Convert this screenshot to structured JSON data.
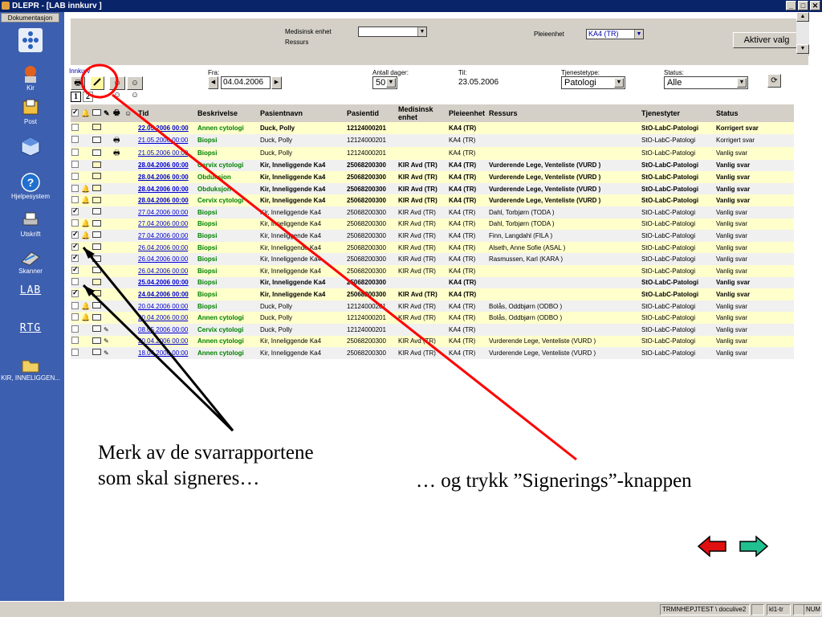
{
  "window": {
    "title": "DLEPR - [LAB innkurv  ]",
    "buttons": [
      "_",
      "□",
      "✕"
    ]
  },
  "sidebar": {
    "tab": "Dokumentasjon",
    "items": [
      {
        "label": "",
        "icon": "grid-dots-icon"
      },
      {
        "label": "Kir",
        "icon": "doctor-icon"
      },
      {
        "label": "Post",
        "icon": "post-icon"
      },
      {
        "label": "",
        "icon": "cube-icon"
      },
      {
        "label": "Hjelpesystem",
        "icon": "help-icon"
      },
      {
        "label": "Utskrift",
        "icon": "printer-icon"
      },
      {
        "label": "Skanner",
        "icon": "scanner-icon"
      }
    ],
    "links": [
      "LAB",
      "RTG"
    ],
    "folder_label": "KIR, INNELIGGEN..."
  },
  "top": {
    "medisinsk_enhet_label": "Medisinsk enhet",
    "ressurs_label": "Ressurs",
    "pleieenhet_label": "Pleieenhet",
    "pleieenhet_value": "KA4 (TR)",
    "aktiver_label": "Aktiver valg"
  },
  "toolbar": {
    "innkurv": "Innkurv",
    "pages": [
      "1",
      "2"
    ],
    "fra_label": "Fra:",
    "fra_value": "04.04.2006",
    "antall_label": "Antall dager:",
    "antall_value": "50",
    "til_label": "Til:",
    "til_value": "23.05.2006",
    "tjenestetype_label": "Tjenestetype:",
    "tjenestetype_value": "Patologi",
    "status_label": "Status:",
    "status_value": "Alle"
  },
  "table": {
    "headers": {
      "tid": "Tid",
      "beskrivelse": "Beskrivelse",
      "pasientnavn": "Pasientnavn",
      "pasientid": "Pasientid",
      "medisinsk_enhet": "Medisinsk enhet",
      "pleieenhet": "Pleieenhet",
      "ressurs": "Ressurs",
      "tjenestyter": "Tjenestyter",
      "status": "Status"
    },
    "rows": [
      {
        "checked": false,
        "bell": false,
        "env": "closed",
        "pen": false,
        "printer": false,
        "tid": "22.05.2006 00:00",
        "beskrivelse": "Annen cytologi",
        "pasientnavn": "Duck, Polly",
        "pasientid": "12124000201",
        "medenhet": "",
        "pleieenhet": "KA4 (TR)",
        "ressurs": "",
        "tjenestyter": "StO-LabC-Patologi",
        "status": "Korrigert svar",
        "bold": true
      },
      {
        "checked": false,
        "bell": false,
        "env": "open",
        "pen": false,
        "printer": true,
        "tid": "21.05.2006 00:00",
        "beskrivelse": "Biopsi",
        "pasientnavn": "Duck, Polly",
        "pasientid": "12124000201",
        "medenhet": "",
        "pleieenhet": "KA4 (TR)",
        "ressurs": "",
        "tjenestyter": "StO-LabC-Patologi",
        "status": "Korrigert svar",
        "bold": false
      },
      {
        "checked": false,
        "bell": false,
        "env": "open",
        "pen": false,
        "printer": true,
        "tid": "21.05.2006 00:00",
        "beskrivelse": "Biopsi",
        "pasientnavn": "Duck, Polly",
        "pasientid": "12124000201",
        "medenhet": "",
        "pleieenhet": "KA4 (TR)",
        "ressurs": "",
        "tjenestyter": "StO-LabC-Patologi",
        "status": "Vanlig svar",
        "bold": false
      },
      {
        "checked": false,
        "bell": false,
        "env": "closed",
        "pen": false,
        "printer": false,
        "tid": "28.04.2006 00:00",
        "beskrivelse": "Cervix cytologi",
        "pasientnavn": "Kir, Inneliggende Ka4",
        "pasientid": "25068200300",
        "medenhet": "KIR Avd (TR)",
        "pleieenhet": "KA4 (TR)",
        "ressurs": "Vurderende Lege, Venteliste (VURD )",
        "tjenestyter": "StO-LabC-Patologi",
        "status": "Vanlig svar",
        "bold": true
      },
      {
        "checked": false,
        "bell": false,
        "env": "closed",
        "pen": false,
        "printer": false,
        "tid": "28.04.2006 00:00",
        "beskrivelse": "Obduksjon",
        "pasientnavn": "Kir, Inneliggende Ka4",
        "pasientid": "25068200300",
        "medenhet": "KIR Avd (TR)",
        "pleieenhet": "KA4 (TR)",
        "ressurs": "Vurderende Lege, Venteliste (VURD )",
        "tjenestyter": "StO-LabC-Patologi",
        "status": "Vanlig svar",
        "bold": true
      },
      {
        "checked": false,
        "bell": true,
        "env": "closed",
        "pen": false,
        "printer": false,
        "tid": "28.04.2006 00:00",
        "beskrivelse": "Obduksjon",
        "pasientnavn": "Kir, Inneliggende Ka4",
        "pasientid": "25068200300",
        "medenhet": "KIR Avd (TR)",
        "pleieenhet": "KA4 (TR)",
        "ressurs": "Vurderende Lege, Venteliste (VURD )",
        "tjenestyter": "StO-LabC-Patologi",
        "status": "Vanlig svar",
        "bold": true
      },
      {
        "checked": false,
        "bell": true,
        "env": "closed",
        "pen": false,
        "printer": false,
        "tid": "28.04.2006 00:00",
        "beskrivelse": "Cervix cytologi",
        "pasientnavn": "Kir, Inneliggende Ka4",
        "pasientid": "25068200300",
        "medenhet": "KIR Avd (TR)",
        "pleieenhet": "KA4 (TR)",
        "ressurs": "Vurderende Lege, Venteliste (VURD )",
        "tjenestyter": "StO-LabC-Patologi",
        "status": "Vanlig svar",
        "bold": true
      },
      {
        "checked": true,
        "bell": false,
        "env": "open",
        "pen": false,
        "printer": false,
        "tid": "27.04.2006 00:00",
        "beskrivelse": "Biopsi",
        "pasientnavn": "Kir, Inneliggende Ka4",
        "pasientid": "25068200300",
        "medenhet": "KIR Avd (TR)",
        "pleieenhet": "KA4 (TR)",
        "ressurs": "Dahl, Torbjørn (TODA )",
        "tjenestyter": "StO-LabC-Patologi",
        "status": "Vanlig svar",
        "bold": false
      },
      {
        "checked": false,
        "bell": true,
        "env": "open",
        "pen": false,
        "printer": false,
        "tid": "27.04.2006 00:00",
        "beskrivelse": "Biopsi",
        "pasientnavn": "Kir, Inneliggende Ka4",
        "pasientid": "25068200300",
        "medenhet": "KIR Avd (TR)",
        "pleieenhet": "KA4 (TR)",
        "ressurs": "Dahl, Torbjørn (TODA )",
        "tjenestyter": "StO-LabC-Patologi",
        "status": "Vanlig svar",
        "bold": false
      },
      {
        "checked": true,
        "bell": true,
        "env": "open",
        "pen": false,
        "printer": false,
        "tid": "27.04.2006 00:00",
        "beskrivelse": "Biopsi",
        "pasientnavn": "Kir, Inneliggende Ka4",
        "pasientid": "25068200300",
        "medenhet": "KIR Avd (TR)",
        "pleieenhet": "KA4 (TR)",
        "ressurs": "Finn, Langdahl (FILA )",
        "tjenestyter": "StO-LabC-Patologi",
        "status": "Vanlig svar",
        "bold": false
      },
      {
        "checked": true,
        "bell": false,
        "env": "open",
        "pen": false,
        "printer": false,
        "tid": "26.04.2006 00:00",
        "beskrivelse": "Biopsi",
        "pasientnavn": "Kir, Inneliggende Ka4",
        "pasientid": "25068200300",
        "medenhet": "KIR Avd (TR)",
        "pleieenhet": "KA4 (TR)",
        "ressurs": "Alseth, Anne Sofie (ASAL )",
        "tjenestyter": "StO-LabC-Patologi",
        "status": "Vanlig svar",
        "bold": false
      },
      {
        "checked": true,
        "bell": false,
        "env": "open",
        "pen": false,
        "printer": false,
        "tid": "26.04.2006 00:00",
        "beskrivelse": "Biopsi",
        "pasientnavn": "Kir, Inneliggende Ka4",
        "pasientid": "25068200300",
        "medenhet": "KIR Avd (TR)",
        "pleieenhet": "KA4 (TR)",
        "ressurs": "Rasmussen, Karl (KARA )",
        "tjenestyter": "StO-LabC-Patologi",
        "status": "Vanlig svar",
        "bold": false
      },
      {
        "checked": true,
        "bell": false,
        "env": "open",
        "pen": false,
        "printer": false,
        "tid": "26.04.2006 00:00",
        "beskrivelse": "Biopsi",
        "pasientnavn": "Kir, Inneliggende Ka4",
        "pasientid": "25068200300",
        "medenhet": "KIR Avd (TR)",
        "pleieenhet": "KA4 (TR)",
        "ressurs": "",
        "tjenestyter": "StO-LabC-Patologi",
        "status": "Vanlig svar",
        "bold": false
      },
      {
        "checked": false,
        "bell": false,
        "env": "closed",
        "pen": false,
        "printer": false,
        "tid": "25.04.2006 00:00",
        "beskrivelse": "Biopsi",
        "pasientnavn": "Kir, Inneliggende Ka4",
        "pasientid": "25068200300",
        "medenhet": "",
        "pleieenhet": "KA4 (TR)",
        "ressurs": "",
        "tjenestyter": "StO-LabC-Patologi",
        "status": "Vanlig svar",
        "bold": true
      },
      {
        "checked": true,
        "bell": false,
        "env": "closed",
        "pen": false,
        "printer": false,
        "tid": "24.04.2006 00:00",
        "beskrivelse": "Biopsi",
        "pasientnavn": "Kir, Inneliggende Ka4",
        "pasientid": "25068200300",
        "medenhet": "KIR Avd (TR)",
        "pleieenhet": "KA4 (TR)",
        "ressurs": "",
        "tjenestyter": "StO-LabC-Patologi",
        "status": "Vanlig svar",
        "bold": true
      },
      {
        "checked": false,
        "bell": true,
        "env": "open",
        "pen": false,
        "printer": false,
        "tid": "20.04.2006 00:00",
        "beskrivelse": "Biopsi",
        "pasientnavn": "Duck, Polly",
        "pasientid": "12124000201",
        "medenhet": "KIR Avd (TR)",
        "pleieenhet": "KA4 (TR)",
        "ressurs": "Bolås, Oddbjørn (ODBO )",
        "tjenestyter": "StO-LabC-Patologi",
        "status": "Vanlig svar",
        "bold": false
      },
      {
        "checked": false,
        "bell": true,
        "env": "open",
        "pen": false,
        "printer": false,
        "tid": "20.04.2006 00:00",
        "beskrivelse": "Annen cytologi",
        "pasientnavn": "Duck, Polly",
        "pasientid": "12124000201",
        "medenhet": "KIR Avd (TR)",
        "pleieenhet": "KA4 (TR)",
        "ressurs": "Bolås, Oddbjørn (ODBO )",
        "tjenestyter": "StO-LabC-Patologi",
        "status": "Vanlig svar",
        "bold": false
      },
      {
        "checked": false,
        "bell": false,
        "env": "open",
        "pen": true,
        "printer": false,
        "tid": "08.05.2006 00:00",
        "beskrivelse": "Cervix cytologi",
        "pasientnavn": "Duck, Polly",
        "pasientid": "12124000201",
        "medenhet": "",
        "pleieenhet": "KA4 (TR)",
        "ressurs": "",
        "tjenestyter": "StO-LabC-Patologi",
        "status": "Vanlig svar",
        "bold": false
      },
      {
        "checked": false,
        "bell": false,
        "env": "open",
        "pen": true,
        "printer": false,
        "tid": "20.04.2006 00:00",
        "beskrivelse": "Annen cytologi",
        "pasientnavn": "Kir, Inneliggende Ka4",
        "pasientid": "25068200300",
        "medenhet": "KIR Avd (TR)",
        "pleieenhet": "KA4 (TR)",
        "ressurs": "Vurderende Lege, Venteliste (VURD )",
        "tjenestyter": "StO-LabC-Patologi",
        "status": "Vanlig svar",
        "bold": false
      },
      {
        "checked": false,
        "bell": false,
        "env": "open",
        "pen": true,
        "printer": false,
        "tid": "18.04.2006 00:00",
        "beskrivelse": "Annen cytologi",
        "pasientnavn": "Kir, Inneliggende Ka4",
        "pasientid": "25068200300",
        "medenhet": "KIR Avd (TR)",
        "pleieenhet": "KA4 (TR)",
        "ressurs": "Vurderende Lege, Venteliste (VURD )",
        "tjenestyter": "StO-LabC-Patologi",
        "status": "Vanlig svar",
        "bold": false
      }
    ]
  },
  "annotations": {
    "caption_left_1": "Merk av de svarrapportene",
    "caption_left_2": "som skal signeres…",
    "caption_right": "… og trykk ”Signerings”-knappen",
    "arrow_color_black": "#000000",
    "circle_color": "#ff0000"
  },
  "statusbar": {
    "user": "TRMNHEPJTEST \\ doculive2",
    "cell2": "",
    "cell3": "kl1-tr",
    "cell4": "",
    "num": "NUM"
  }
}
